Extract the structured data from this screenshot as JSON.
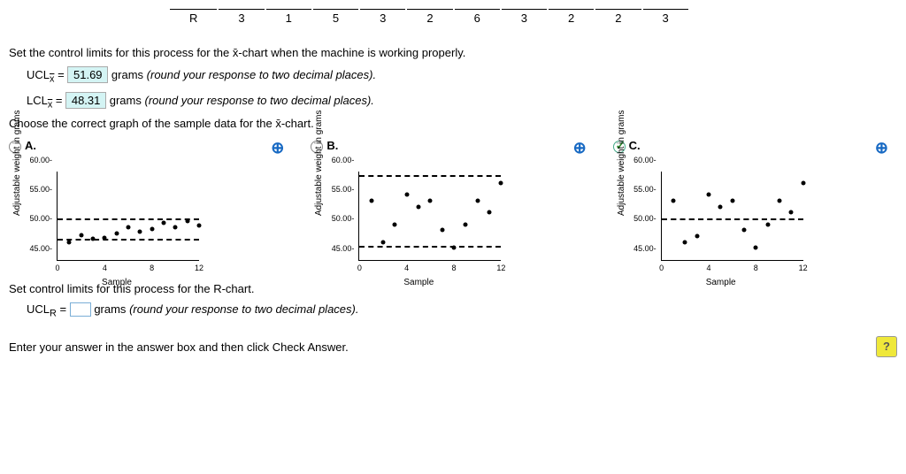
{
  "table": {
    "label": "R",
    "cells": [
      "3",
      "1",
      "5",
      "3",
      "2",
      "6",
      "3",
      "2",
      "2",
      "3"
    ]
  },
  "prompt1": "Set the control limits for this process for the x̄-chart when the machine is working properly.",
  "ucl": {
    "prefix": "UCL",
    "sub": "x̄",
    "eq": "=",
    "value": "51.69",
    "unit": "grams",
    "note": "(round your response to two decimal places)."
  },
  "lcl": {
    "prefix": "LCL",
    "sub": "x̄",
    "eq": "=",
    "value": "48.31",
    "unit": "grams",
    "note": "(round your response to two decimal places)."
  },
  "prompt2": "Choose the correct graph of the sample data for the x̄-chart.",
  "options": {
    "A": "A.",
    "B": "B.",
    "C": "C.",
    "ylabel": "Adjustable weight in grams",
    "xlabel": "Sample",
    "yticks": [
      "60.00",
      "55.00",
      "50.00",
      "45.00"
    ],
    "xticks": [
      "0",
      "4",
      "8",
      "12"
    ]
  },
  "prompt3": "Set control limits for this process for the R-chart.",
  "uclr": {
    "prefix": "UCL",
    "sub": "R",
    "eq": "=",
    "unit": "grams",
    "note": "(round your response to two decimal places)."
  },
  "footer": "Enter your answer in the answer box and then click Check Answer.",
  "help": "?",
  "chart_data": [
    {
      "type": "scatter",
      "label": "A",
      "ylim": [
        45,
        60
      ],
      "xlim": [
        0,
        12
      ],
      "limits": [
        51.69,
        48.31
      ],
      "points": [
        [
          1,
          48
        ],
        [
          2,
          49.2
        ],
        [
          3,
          48.5
        ],
        [
          4,
          48.7
        ],
        [
          5,
          49.5
        ],
        [
          6,
          50.5
        ],
        [
          7,
          49.8
        ],
        [
          8,
          50.2
        ],
        [
          9,
          51.2
        ],
        [
          10,
          50.5
        ],
        [
          11,
          51.5
        ],
        [
          12,
          50.8
        ]
      ]
    },
    {
      "type": "scatter",
      "label": "B",
      "ylim": [
        45,
        60
      ],
      "xlim": [
        0,
        12
      ],
      "limits": [
        59,
        47
      ],
      "points": [
        [
          1,
          55
        ],
        [
          2,
          48
        ],
        [
          3,
          51
        ],
        [
          4,
          56
        ],
        [
          5,
          54
        ],
        [
          6,
          55
        ],
        [
          7,
          50
        ],
        [
          8,
          47
        ],
        [
          9,
          51
        ],
        [
          10,
          55
        ],
        [
          11,
          53
        ],
        [
          12,
          58
        ]
      ]
    },
    {
      "type": "scatter",
      "label": "C",
      "ylim": [
        45,
        60
      ],
      "xlim": [
        0,
        12
      ],
      "limits": [
        51.69,
        51.69
      ],
      "points": [
        [
          1,
          55
        ],
        [
          2,
          48
        ],
        [
          3,
          49
        ],
        [
          4,
          56
        ],
        [
          5,
          54
        ],
        [
          6,
          55
        ],
        [
          7,
          50
        ],
        [
          8,
          47
        ],
        [
          9,
          51
        ],
        [
          10,
          55
        ],
        [
          11,
          53
        ],
        [
          12,
          58
        ]
      ]
    }
  ]
}
